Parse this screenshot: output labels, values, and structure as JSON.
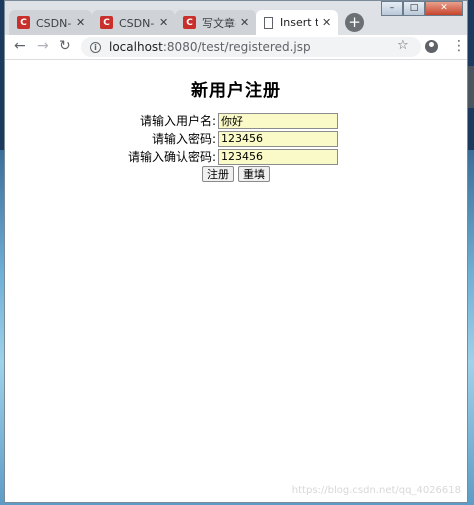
{
  "tabs": [
    {
      "icon": "C",
      "title": "CSDN-专",
      "active": false
    },
    {
      "icon": "C",
      "title": "CSDN-专",
      "active": false
    },
    {
      "icon": "C",
      "title": "写文章-C",
      "active": false
    },
    {
      "icon": "page",
      "title": "Insert title",
      "active": true
    }
  ],
  "window_controls": {
    "minimize": "–",
    "maximize": "□",
    "close": "✕"
  },
  "toolbar": {
    "url_host": "localhost",
    "url_rest": ":8080/test/registered.jsp"
  },
  "page": {
    "title": "新用户注册",
    "fields": [
      {
        "label": "请输入用户名:",
        "value": "你好",
        "type": "text"
      },
      {
        "label": "请输入密码:",
        "value": "123456",
        "type": "text"
      },
      {
        "label": "请输入确认密码:",
        "value": "123456",
        "type": "text"
      }
    ],
    "submit_label": "注册",
    "reset_label": "重填"
  },
  "watermark": "https://blog.csdn.net/qq_4026618",
  "colors": {
    "input_bg": "#fafac8",
    "favicon_red": "#c9302c"
  }
}
